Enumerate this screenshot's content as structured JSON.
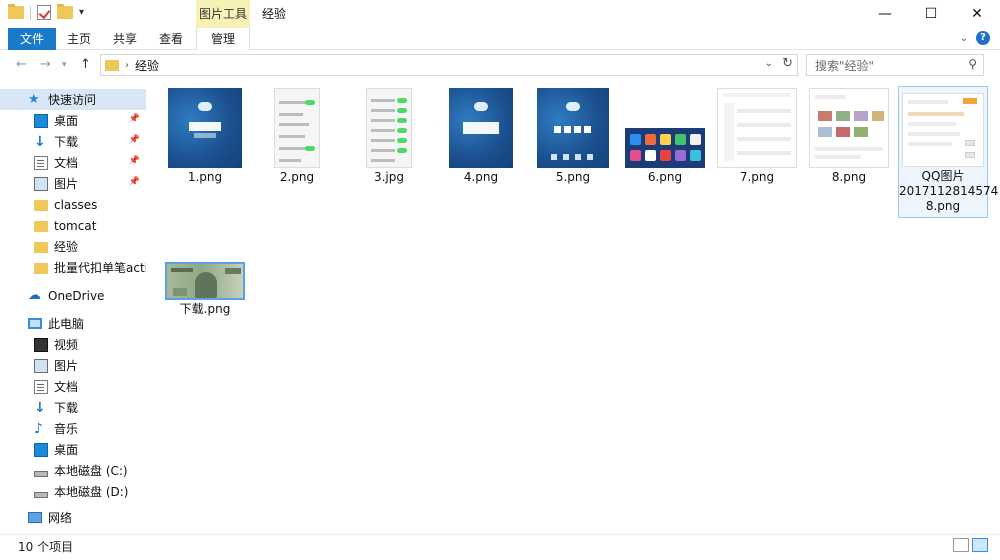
{
  "window": {
    "title": "经验",
    "context_tab_header": "图片工具",
    "controls": [
      "—",
      "☐",
      "✕"
    ]
  },
  "ribbon": {
    "tabs": [
      {
        "id": "file",
        "label": "文件"
      },
      {
        "id": "home",
        "label": "主页"
      },
      {
        "id": "share",
        "label": "共享"
      },
      {
        "id": "view",
        "label": "查看"
      },
      {
        "id": "manage",
        "label": "管理"
      }
    ]
  },
  "address": {
    "breadcrumb": "经验",
    "search_placeholder": "搜索\"经验\""
  },
  "sidebar": {
    "quick_access": {
      "label": "快速访问",
      "items": [
        {
          "label": "桌面",
          "icon": "desktop-icon",
          "pinned": true
        },
        {
          "label": "下载",
          "icon": "download-icon",
          "pinned": true
        },
        {
          "label": "文档",
          "icon": "document-icon",
          "pinned": true
        },
        {
          "label": "图片",
          "icon": "pictures-icon",
          "pinned": true
        },
        {
          "label": "classes",
          "icon": "folder-icon",
          "pinned": false
        },
        {
          "label": "tomcat",
          "icon": "folder-icon",
          "pinned": false
        },
        {
          "label": "经验",
          "icon": "folder-icon",
          "pinned": false
        },
        {
          "label": "批量代扣单笔action",
          "icon": "folder-icon",
          "pinned": false
        }
      ]
    },
    "onedrive": {
      "label": "OneDrive"
    },
    "this_pc": {
      "label": "此电脑",
      "items": [
        {
          "label": "视频",
          "icon": "video-icon"
        },
        {
          "label": "图片",
          "icon": "pictures-icon"
        },
        {
          "label": "文档",
          "icon": "document-icon"
        },
        {
          "label": "下载",
          "icon": "download-icon"
        },
        {
          "label": "音乐",
          "icon": "music-icon"
        },
        {
          "label": "桌面",
          "icon": "desktop-icon"
        },
        {
          "label": "本地磁盘 (C:)",
          "icon": "drive-icon"
        },
        {
          "label": "本地磁盘 (D:)",
          "icon": "drive-icon"
        }
      ]
    },
    "network": {
      "label": "网络"
    }
  },
  "files": [
    {
      "name": "1.png"
    },
    {
      "name": "2.png"
    },
    {
      "name": "3.jpg"
    },
    {
      "name": "4.png"
    },
    {
      "name": "5.png"
    },
    {
      "name": "6.png"
    },
    {
      "name": "7.png"
    },
    {
      "name": "8.png"
    },
    {
      "name": "QQ图片20171128145748.png",
      "name_lines": [
        "QQ图片",
        "2017112814574",
        "8.png"
      ]
    },
    {
      "name": "下载.png"
    }
  ],
  "status": {
    "item_count": "10 个项目"
  }
}
